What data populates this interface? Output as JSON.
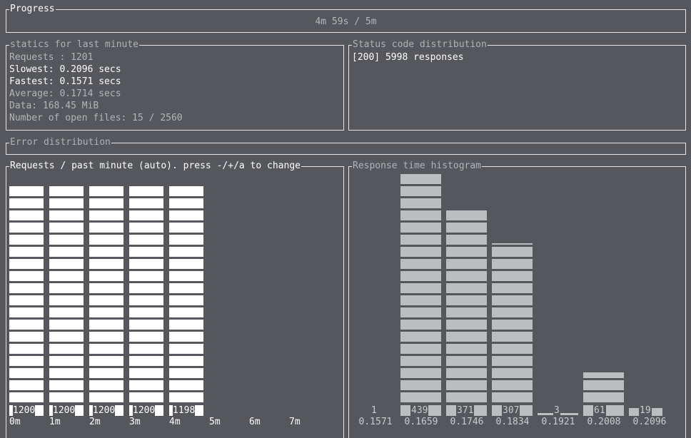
{
  "progress": {
    "title": "Progress",
    "text": "4m 59s / 5m"
  },
  "statistics": {
    "title": "statics for last minute",
    "requests": "Requests : 1201",
    "slowest": "Slowest: 0.2096 secs",
    "fastest": "Fastest: 0.1571 secs",
    "average": "Average: 0.1714 secs",
    "data": "Data: 168.45 MiB",
    "open_files": "Number of open files: 15 / 2560"
  },
  "status_codes": {
    "title": "Status code distribution",
    "line": "[200] 5998 responses"
  },
  "errors": {
    "title": "Error distribution"
  },
  "chart_data": [
    {
      "type": "bar",
      "title": "Requests / past minute (auto). press -/+/a to change",
      "categories": [
        "0m",
        "1m",
        "2m",
        "3m",
        "4m",
        "5m",
        "6m",
        "7m"
      ],
      "values": [
        1200,
        1200,
        1200,
        1200,
        1198,
        0,
        0,
        0
      ],
      "value_labels": [
        "1200",
        "1200",
        "1200",
        "1200",
        "1198",
        "",
        "",
        ""
      ],
      "ylim": [
        0,
        1200
      ]
    },
    {
      "type": "bar",
      "title": "Response time histogram",
      "categories": [
        "0.1571",
        "0.1659",
        "0.1746",
        "0.1834",
        "0.1921",
        "0.2008",
        "0.2096"
      ],
      "values": [
        1,
        439,
        371,
        307,
        3,
        61,
        19
      ],
      "value_labels": [
        "1",
        "439",
        "371",
        "307",
        "3",
        "61",
        "19"
      ],
      "ylim": [
        0,
        439
      ]
    }
  ]
}
